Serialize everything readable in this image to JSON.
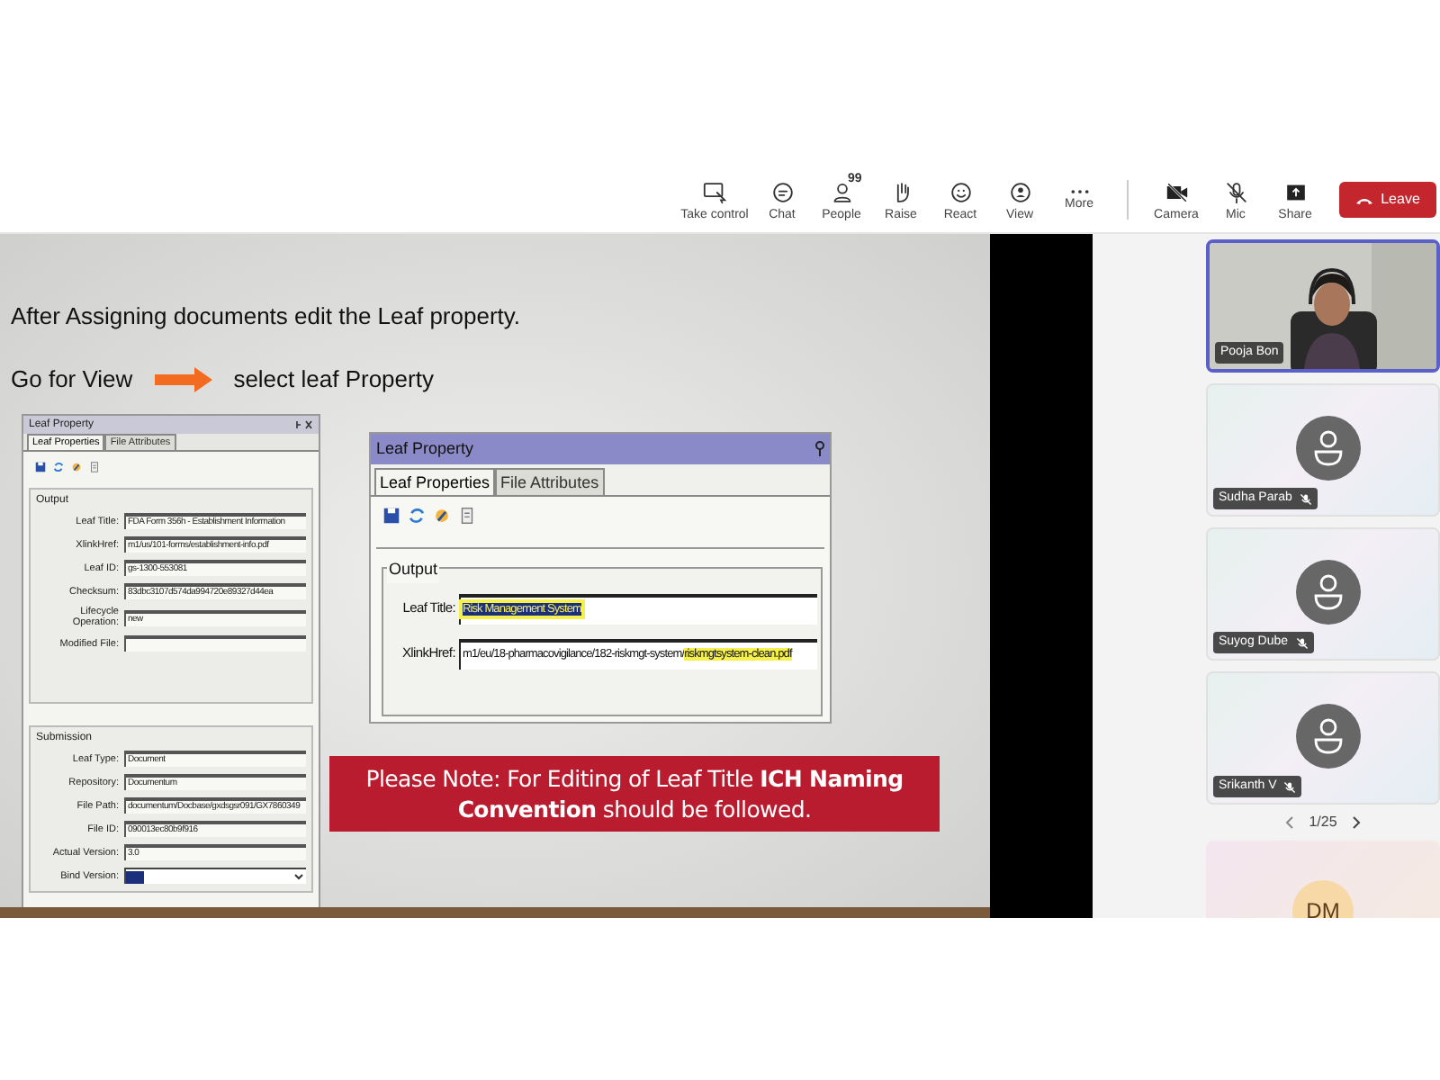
{
  "toolbar": {
    "items": [
      {
        "kind": "take-control",
        "label": "Take control"
      },
      {
        "kind": "chat",
        "label": "Chat"
      },
      {
        "kind": "people",
        "label": "People",
        "badge": "99"
      },
      {
        "kind": "raise",
        "label": "Raise"
      },
      {
        "kind": "react",
        "label": "React"
      },
      {
        "kind": "view",
        "label": "View"
      },
      {
        "kind": "more",
        "label": "More"
      },
      {
        "kind": "camera",
        "label": "Camera"
      },
      {
        "kind": "mic",
        "label": "Mic"
      },
      {
        "kind": "share",
        "label": "Share"
      }
    ],
    "leave_button": "Leave"
  },
  "slide": {
    "heading": "After Assigning documents edit the Leaf property.",
    "step_left": "Go for View",
    "step_right": "select leaf Property",
    "small_dialog": {
      "title": "Leaf Property",
      "tabs": [
        {
          "label": "Leaf Properties",
          "selected": true
        },
        {
          "label": "File Attributes",
          "selected": false
        }
      ],
      "groups": [
        {
          "title": "Output",
          "fields": [
            {
              "label": "Leaf Title:",
              "value": "FDA Form 356h - Establishment Information"
            },
            {
              "label": "XlinkHref:",
              "value": "m1/us/101-forms/establishment-info.pdf"
            },
            {
              "label": "Leaf ID:",
              "value": "gs-1300-553081"
            },
            {
              "label": "Checksum:",
              "value": "83dbc3107d574da994720e89327d44ea"
            },
            {
              "label": "Lifecycle Operation:",
              "value": "new"
            },
            {
              "label": "Modified File:"
            }
          ]
        },
        {
          "title": "Submission",
          "fields": [
            {
              "label": "Leaf Type:",
              "value": "Document"
            },
            {
              "label": "Repository:",
              "value": "Documentum"
            },
            {
              "label": "File Path:",
              "value": "documentum/Docbase/gxdsgsr091/GX7860349"
            },
            {
              "label": "File ID:",
              "value": "090013ec80b9f916"
            },
            {
              "label": "Actual Version:",
              "value": "3.0"
            },
            {
              "label": "Bind Version:",
              "kind": "select"
            }
          ]
        }
      ]
    },
    "large_dialog": {
      "title": "Leaf Property",
      "tabs": [
        {
          "label": "Leaf Properties",
          "selected": true
        },
        {
          "label": "File Attributes",
          "selected": false
        }
      ],
      "group_title": "Output",
      "fields": [
        {
          "label": "Leaf Title:",
          "parts": [
            {
              "text": "Risk Management System",
              "highlighted": true
            }
          ]
        },
        {
          "label": "XlinkHref:",
          "parts": [
            {
              "text": "m1/eu/18-pharmacovigilance/182-riskmgt-system/",
              "highlighted": false
            },
            {
              "text": "riskmgtsystem-clean.pdf",
              "highlighted": true
            }
          ]
        }
      ]
    },
    "note": "Please Note: For Editing  of Leaf Title **ICH Naming Convention** should be followed."
  },
  "participants": [
    {
      "name": "Pooja Bon",
      "kind": "video",
      "selected": true
    },
    {
      "name": "Sudha Parab",
      "kind": "avatar",
      "muted": true,
      "selected": false
    },
    {
      "name": "Suyog Dube",
      "kind": "avatar",
      "muted": true,
      "selected": false
    },
    {
      "name": "Srikanth V",
      "kind": "avatar",
      "muted": true,
      "selected": false
    }
  ],
  "pager": "1/25",
  "next_tile": {
    "initials": "DM"
  }
}
